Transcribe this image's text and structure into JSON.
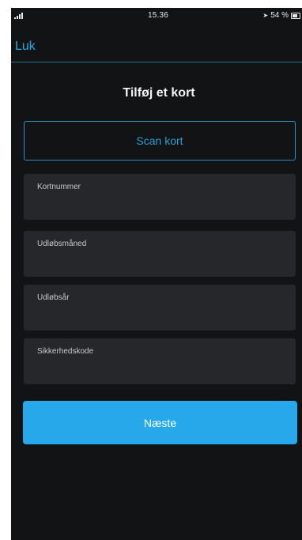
{
  "status_bar": {
    "time": "15.36",
    "battery_text": "54 %",
    "icons": [
      "signal-icon",
      "location-icon",
      "battery-icon"
    ]
  },
  "nav": {
    "close_label": "Luk"
  },
  "title": "Tilføj et kort",
  "scan_button_label": "Scan kort",
  "fields": [
    {
      "label": "Kortnummer",
      "value": "",
      "placeholder": ""
    },
    {
      "label": "Udløbsmåned",
      "value": "",
      "placeholder": ""
    },
    {
      "label": "Udløbsår",
      "value": "",
      "placeholder": ""
    },
    {
      "label": "Sikkerhedskode",
      "value": "",
      "placeholder": ""
    }
  ],
  "next_button_label": "Næste",
  "colors": {
    "background": "#111315",
    "accent": "#26a8ea",
    "field_background": "#25272a",
    "link": "#2da8e0"
  }
}
